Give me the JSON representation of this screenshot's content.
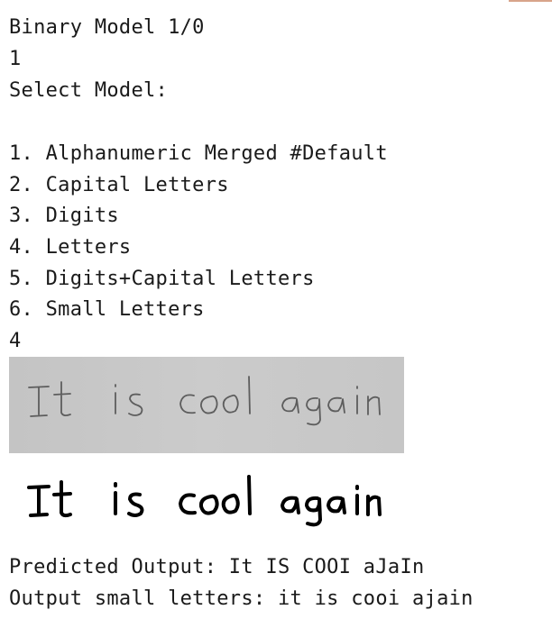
{
  "console": {
    "prompt_binary": "Binary Model 1/0",
    "input_binary": "1",
    "select_model": "Select Model:",
    "options": [
      "1. Alphanumeric Merged #Default",
      "2. Capital Letters",
      "3. Digits",
      "4. Letters",
      "5. Digits+Capital Letters",
      "6. Small Letters"
    ],
    "input_model": "4",
    "predicted_output": "Predicted Output: It IS COOI aJaIn",
    "small_letters_output": "Output small letters: it is cooi ajain"
  },
  "images": {
    "scan_text": "It is cool again",
    "binarized_text": "It is cool again"
  },
  "colors": {
    "text": "#1a1a1a",
    "scan_background": "#c8c8c8",
    "scan_ink": "#5a5a5a",
    "binary_ink": "#000000"
  }
}
